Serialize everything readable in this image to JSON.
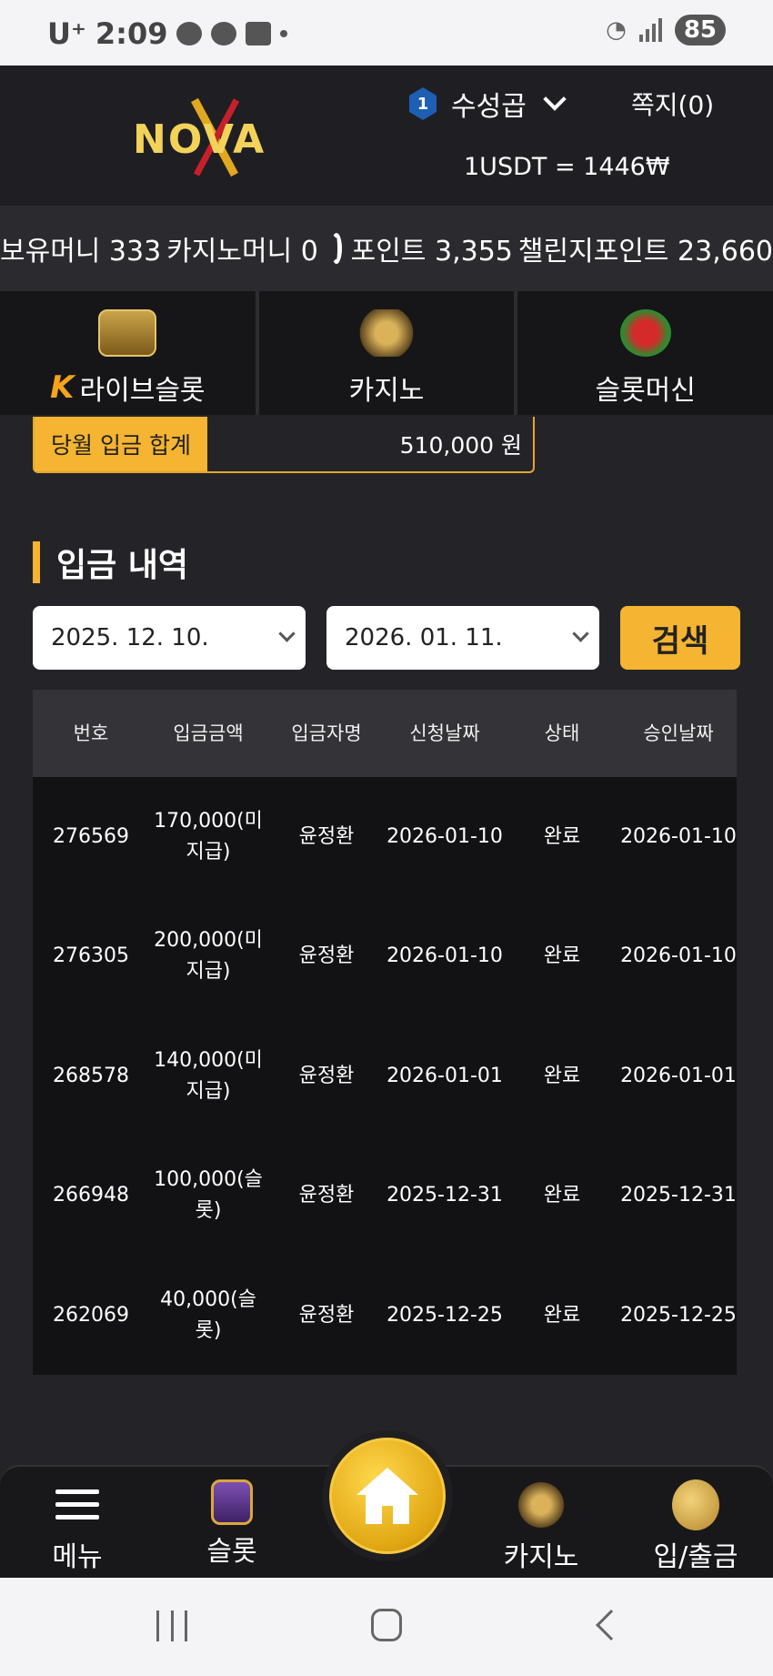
{
  "status_bar": {
    "carrier": "U⁺",
    "time": "2:09",
    "battery": "85"
  },
  "header": {
    "logo_text": "NOVA",
    "rank_number": "1",
    "username": "수성곱",
    "messages_label": "쪽지(0)",
    "rate": "1USDT = 1446₩"
  },
  "balances": {
    "holding": "보유머니 333",
    "casino": "카지노머니 0",
    "point": "포인트 3,355",
    "challenge": "챌린지포인트 23,660"
  },
  "categories": [
    {
      "label": "라이브슬롯",
      "icon": "live-slot-icon",
      "badge": "K"
    },
    {
      "label": "카지노",
      "icon": "k-slot-casino-icon"
    },
    {
      "label": "슬롯머신",
      "icon": "777-slots-icon"
    }
  ],
  "summary": {
    "label": "당월 입금 합계",
    "value": "510,000 원"
  },
  "section_title": "입금 내역",
  "filters": {
    "from": "2025. 12. 10.",
    "to": "2026. 01. 11.",
    "search_label": "검색"
  },
  "table": {
    "headers": [
      "번호",
      "입금금액",
      "입금자명",
      "신청날짜",
      "상태",
      "승인날짜"
    ],
    "rows": [
      [
        "276569",
        "170,000(미지급)",
        "윤정환",
        "2026-01-10",
        "완료",
        "2026-01-10"
      ],
      [
        "276305",
        "200,000(미지급)",
        "윤정환",
        "2026-01-10",
        "완료",
        "2026-01-10"
      ],
      [
        "268578",
        "140,000(미지급)",
        "윤정환",
        "2026-01-01",
        "완료",
        "2026-01-01"
      ],
      [
        "266948",
        "100,000(슬롯)",
        "윤정환",
        "2025-12-31",
        "완료",
        "2025-12-31"
      ],
      [
        "262069",
        "40,000(슬롯)",
        "윤정환",
        "2025-12-25",
        "완료",
        "2025-12-25"
      ]
    ]
  },
  "bottom_nav": {
    "menu": "메뉴",
    "slot": "슬롯",
    "casino": "카지노",
    "deposit": "입/출금"
  },
  "colors": {
    "accent": "#f5b431",
    "background": "#242428"
  }
}
